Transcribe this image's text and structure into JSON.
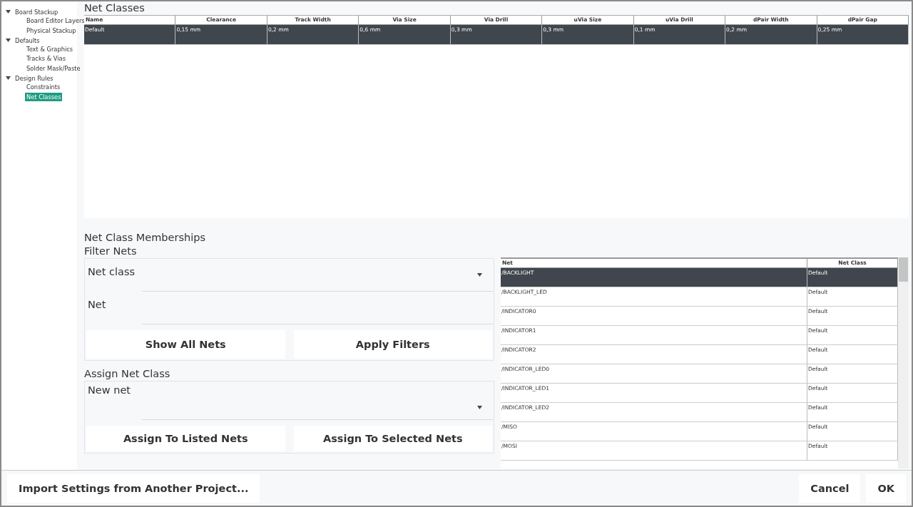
{
  "tree": [
    {
      "label": "Board Stackup",
      "expanded": true,
      "children": [
        {
          "label": "Board Editor Layers",
          "selected": false
        },
        {
          "label": "Physical Stackup",
          "selected": false
        }
      ]
    },
    {
      "label": "Defaults",
      "expanded": true,
      "children": [
        {
          "label": "Text & Graphics",
          "selected": false
        },
        {
          "label": "Tracks & Vias",
          "selected": false
        },
        {
          "label": "Solder Mask/Paste",
          "selected": false
        }
      ]
    },
    {
      "label": "Design Rules",
      "expanded": true,
      "children": [
        {
          "label": "Constraints",
          "selected": false
        },
        {
          "label": "Net Classes",
          "selected": true
        }
      ]
    }
  ],
  "net_classes": {
    "title": "Net Classes",
    "columns": [
      "Name",
      "Clearance",
      "Track Width",
      "Via Size",
      "Via Drill",
      "uVia Size",
      "uVia Drill",
      "dPair Width",
      "dPair Gap"
    ],
    "rows": [
      {
        "selected": true,
        "cells": [
          "Default",
          "0,15 mm",
          "0,2 mm",
          "0,6 mm",
          "0,3 mm",
          "0,3 mm",
          "0,1 mm",
          "0,2 mm",
          "0,25 mm"
        ]
      }
    ]
  },
  "memberships": {
    "title": "Net Class Memberships",
    "filter": {
      "title": "Filter Nets",
      "net_class_label": "Net class",
      "net_label": "Net",
      "buttons": [
        "Show All Nets",
        "Apply Filters"
      ]
    },
    "assign": {
      "title": "Assign Net Class",
      "label": "New net",
      "buttons": [
        "Assign To Listed Nets",
        "Assign To Selected Nets"
      ]
    },
    "table": {
      "columns": [
        "Net",
        "Net Class"
      ],
      "rows": [
        {
          "net": "/BACKLIGHT",
          "net_class": "Default",
          "selected": true
        },
        {
          "net": "/BACKLIGHT_LED",
          "net_class": "Default",
          "selected": false
        },
        {
          "net": "/INDICATOR0",
          "net_class": "Default",
          "selected": false
        },
        {
          "net": "/INDICATOR1",
          "net_class": "Default",
          "selected": false
        },
        {
          "net": "/INDICATOR2",
          "net_class": "Default",
          "selected": false
        },
        {
          "net": "/INDICATOR_LED0",
          "net_class": "Default",
          "selected": false
        },
        {
          "net": "/INDICATOR_LED1",
          "net_class": "Default",
          "selected": false
        },
        {
          "net": "/INDICATOR_LED2",
          "net_class": "Default",
          "selected": false
        },
        {
          "net": "/MISO",
          "net_class": "Default",
          "selected": false
        },
        {
          "net": "/MOSI",
          "net_class": "Default",
          "selected": false
        }
      ]
    }
  },
  "footer": {
    "import_button": "Import Settings from Another Project...",
    "buttons": [
      "Cancel",
      "OK"
    ]
  }
}
